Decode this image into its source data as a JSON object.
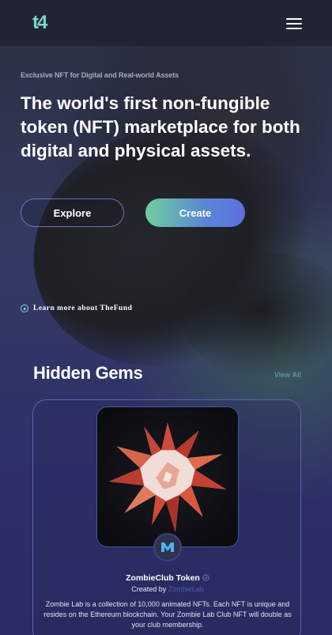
{
  "header": {
    "logo_text": "t4",
    "menu_icon": "hamburger-menu-icon"
  },
  "hero": {
    "eyebrow": "Exclusive NFT for Digital and Real-world Assets",
    "headline": "The world's first non-fungible token (NFT) marketplace for both digital and physical assets.",
    "explore_label": "Explore",
    "create_label": "Create",
    "learn_more_label": "Learn more about TheFund"
  },
  "gems": {
    "title": "Hidden Gems",
    "view_all_label": "View All",
    "card": {
      "token_name": "ZombieClub Token",
      "created_by_prefix": "Created by",
      "creator": "ZombieLab",
      "description": "Zombie Lab is a collection of 10,000 animated NFTs. Each NFT is unique and resides on the Ethereum blockchain. Your Zombie Lab Club NFT will double as your club membership."
    }
  },
  "colors": {
    "accent_teal": "#7fd6c9",
    "create_gradient_start": "#6fcf9c",
    "create_gradient_end": "#5d6fe0",
    "card_border": "#5a63ad"
  }
}
